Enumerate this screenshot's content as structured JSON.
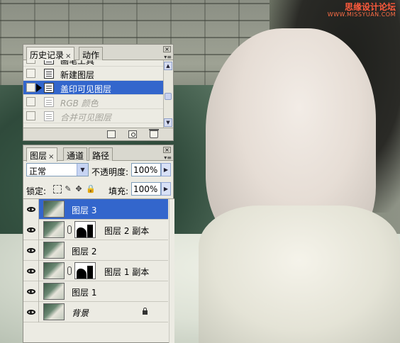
{
  "watermark": {
    "site_cn": "思缘设计论坛",
    "site_url": "WWW.MISSYUAN.COM"
  },
  "history_panel": {
    "tabs": [
      {
        "label": "历史记录",
        "close": "×"
      },
      {
        "label": "动作"
      }
    ],
    "items": [
      {
        "label": "画笔工具",
        "state": "normal"
      },
      {
        "label": "新建图层",
        "state": "normal"
      },
      {
        "label": "盖印可见图层",
        "state": "selected"
      },
      {
        "label": "RGB 颜色",
        "state": "dim"
      },
      {
        "label": "合并可见图层",
        "state": "dim"
      }
    ]
  },
  "layers_panel": {
    "tabs": [
      {
        "label": "图层",
        "close": "×"
      },
      {
        "label": "通道"
      },
      {
        "label": "路径"
      }
    ],
    "blend_mode": "正常",
    "opacity_label": "不透明度:",
    "opacity_value": "100%",
    "lock_label": "锁定:",
    "fill_label": "填充:",
    "fill_value": "100%",
    "layers": [
      {
        "name": "图层 3",
        "selected": true,
        "mask": false
      },
      {
        "name": "图层 2 副本",
        "selected": false,
        "mask": true
      },
      {
        "name": "图层 2",
        "selected": false,
        "mask": false
      },
      {
        "name": "图层 1 副本",
        "selected": false,
        "mask": true
      },
      {
        "name": "图层 1",
        "selected": false,
        "mask": false
      },
      {
        "name": "背景",
        "selected": false,
        "mask": false,
        "italic": true,
        "locked": true
      }
    ]
  },
  "colors": {
    "selection": "#3366cc",
    "panel_bg": "#ecebe3",
    "watermark": "#ff5a3c"
  }
}
